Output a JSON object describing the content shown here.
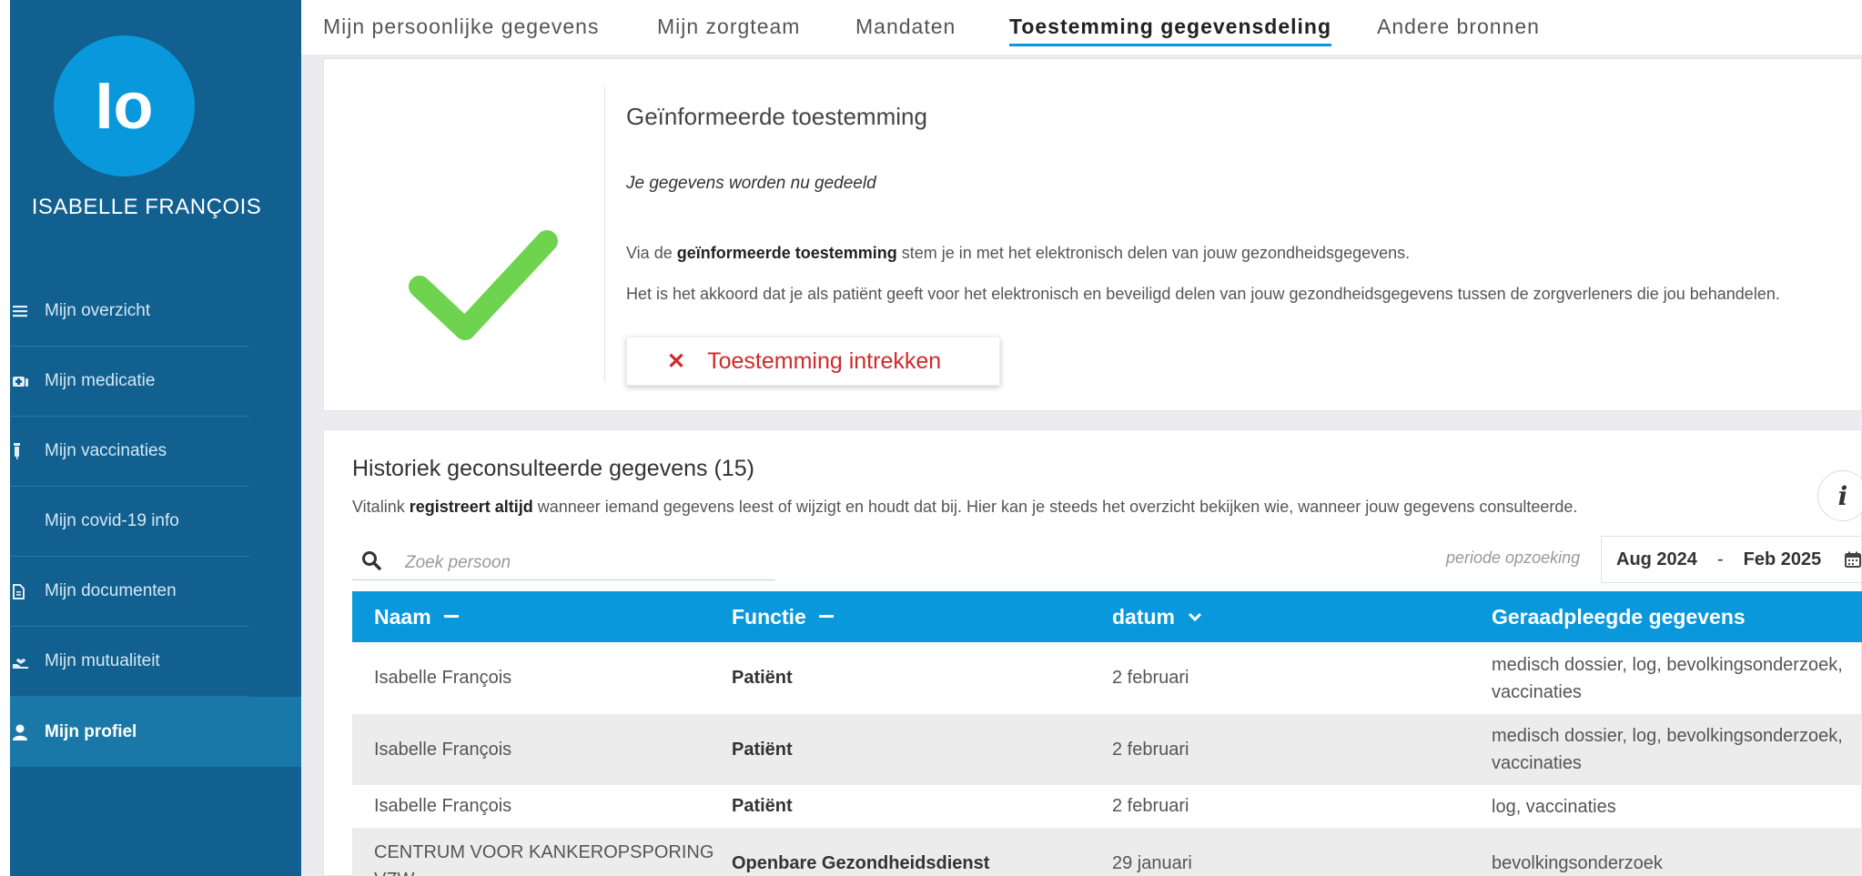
{
  "sidebar": {
    "avatar_initials": "Io",
    "user_name": "ISABELLE FRANÇOIS",
    "items": [
      {
        "label": "Mijn overzicht",
        "icon": "list-icon"
      },
      {
        "label": "Mijn medicatie",
        "icon": "medication-icon"
      },
      {
        "label": "Mijn vaccinaties",
        "icon": "vaccine-icon"
      },
      {
        "label": "Mijn covid-19 info",
        "icon": ""
      },
      {
        "label": "Mijn documenten",
        "icon": "document-icon"
      },
      {
        "label": "Mijn mutualiteit",
        "icon": "hand-heart-icon"
      },
      {
        "label": "Mijn profiel",
        "icon": "user-icon",
        "active": true
      }
    ]
  },
  "tabs": [
    {
      "label": "Mijn persoonlijke gegevens"
    },
    {
      "label": "Mijn zorgteam"
    },
    {
      "label": "Mandaten"
    },
    {
      "label": "Toestemming gegevensdeling",
      "active": true
    },
    {
      "label": "Andere bronnen"
    }
  ],
  "consent": {
    "title": "Geïnformeerde toestemming",
    "status": "Je gegevens worden nu gedeeld",
    "p1_prefix": "Via de ",
    "p1_bold": "geïnformeerde toestemming",
    "p1_suffix": " stem je in met het elektronisch delen van jouw gezondheidsgegevens.",
    "p2": "Het is het akkoord dat je als patiënt geeft voor het elektronisch en beveiligd delen van jouw gezondheidsgegevens tussen de zorgverleners die jou behandelen.",
    "revoke_label": "Toestemming intrekken",
    "check_color": "#6ed44f",
    "revoke_color": "#d12a2a"
  },
  "history": {
    "title": "Historiek geconsulteerde gegevens",
    "count": "(15)",
    "desc_prefix": "Vitalink ",
    "desc_bold": "registreert altijd",
    "desc_suffix": " wanneer iemand gegevens leest of wijzigt en houdt dat bij. Hier kan je steeds het overzicht bekijken wie, wanneer jouw gegevens consulteerde.",
    "search_placeholder": "Zoek persoon",
    "period_label": "periode opzoeking",
    "period_from": "Aug 2024",
    "period_sep": "-",
    "period_to": "Feb 2025",
    "columns": [
      {
        "label": "Naam"
      },
      {
        "label": "Functie"
      },
      {
        "label": "datum"
      },
      {
        "label": "Geraadpleegde gegevens"
      }
    ],
    "rows": [
      {
        "name": "Isabelle François",
        "function": "Patiënt",
        "date": "2 februari",
        "data": "medisch dossier, log, bevolkingsonderzoek, vaccinaties"
      },
      {
        "name": "Isabelle François",
        "function": "Patiënt",
        "date": "2 februari",
        "data": "medisch dossier, log, bevolkingsonderzoek, vaccinaties"
      },
      {
        "name": "Isabelle François",
        "function": "Patiënt",
        "date": "2 februari",
        "data": "log, vaccinaties"
      },
      {
        "name": "CENTRUM VOOR KANKEROPSPORING VZW",
        "function": "Openbare Gezondheidsdienst",
        "date": "29 januari",
        "data": "bevolkingsonderzoek"
      }
    ],
    "header_color": "#0a98dc"
  }
}
